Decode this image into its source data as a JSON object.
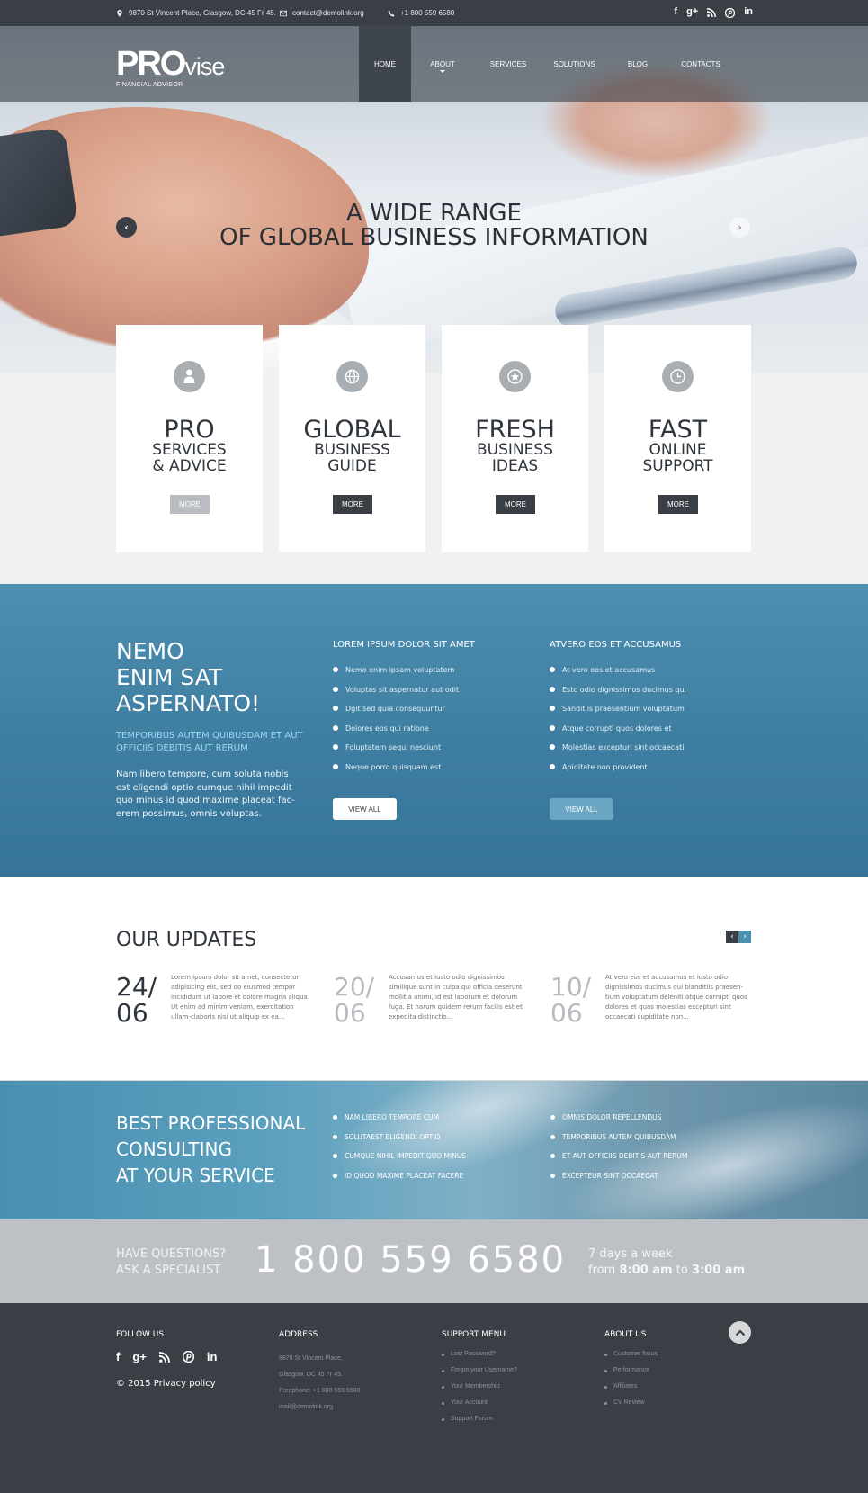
{
  "topbar": {
    "address": "9870 St Vincent Place, Glasgow, DC 45 Fr 45.",
    "email": "contact@demolink.org",
    "phone": "+1 800 559 6580",
    "socials": [
      "f",
      "g+",
      "rss",
      "p",
      "in"
    ]
  },
  "logo": {
    "bold": "PRO",
    "light": "vise",
    "tagline": "FINANCIAL ADVISOR"
  },
  "nav": {
    "items": [
      "HOME",
      "ABOUT",
      "SERVICES",
      "SOLUTIONS",
      "BLOG",
      "CONTACTS"
    ],
    "active": "HOME"
  },
  "hero": {
    "line1": "A WIDE RANGE",
    "line2": "OF GLOBAL BUSINESS INFORMATION",
    "prev": "‹",
    "next": "›"
  },
  "features": [
    {
      "icon": "person-icon",
      "l1": "PRO",
      "l2": "SERVICES",
      "l3": "& ADVICE",
      "button": "MORE",
      "button_color": "#b9bcc0"
    },
    {
      "icon": "globe-icon",
      "l1": "GLOBAL",
      "l2": "BUSINESS",
      "l3": "GUIDE",
      "button": "MORE",
      "button_color": "#3a3f46"
    },
    {
      "icon": "star-icon",
      "l1": "FRESH",
      "l2": "BUSINESS",
      "l3": "IDEAS",
      "button": "MORE",
      "button_color": "#3a3f46"
    },
    {
      "icon": "clock-icon",
      "l1": "FAST",
      "l2": "ONLINE",
      "l3": "SUPPORT",
      "button": "MORE",
      "button_color": "#3a3f46"
    }
  ],
  "info": {
    "heading": [
      "NEMO",
      "ENIM SAT",
      "ASPERNATO!"
    ],
    "subheading": "TEMPORIBUS AUTEM QUIBUSDAM ET AUT OFFICIIS DEBITIS AUT RERUM",
    "paragraph": "Nam libero tempore, cum soluta nobis est eligendi optio cumque nihil impedit quo minus id quod maxime placeat fac-erem possimus, omnis voluptas.",
    "col1": {
      "title": "LOREM IPSUM DOLOR SIT AMET",
      "items": [
        "Nemo enim ipsam voluptatem",
        "Voluptas sit aspernatur aut odit",
        "Dgit sed quia consequuntur",
        "Dolores eos qui ratione",
        "Foluptatem sequi nesciunt",
        "Neque porro quisquam est"
      ],
      "button": "VIEW ALL"
    },
    "col2": {
      "title": "ATVERO EOS ET ACCUSAMUS",
      "items": [
        "At vero eos et accusamus",
        "Esto odio dignissimos ducimus qui",
        "Sanditiis praesentium voluptatum",
        "Atque corrupti quos dolores et",
        "Molestias excepturi sint occaecati",
        "Apiditate non provident"
      ],
      "button": "VIEW ALL"
    }
  },
  "updates": {
    "title": "OUR UPDATES",
    "prev": "‹",
    "next": "›",
    "posts": [
      {
        "day": "24/",
        "month": "06",
        "text": "Lorem ipsum dolor sit amet, consectetur adipisicing elit, sed do eiusmod tempor incididunt ut labore et dolore magna aliqua. Ut enim ad minim veniam, exercitation ullam-claboris nisi ut aliquip ex ea..."
      },
      {
        "day": "20/",
        "month": "06",
        "text": "Accusamus et iusto odio dignissimos similique sunt in culpa qui officia deserunt mollitia animi, id est laborum et dolorum fuga. Et harum quidem rerum facilis est et expedita distinctio..."
      },
      {
        "day": "10/",
        "month": "06",
        "text": "At vero eos et accusamus et iusto odio dignissimos ducimus qui blanditiis praesen-tium voluptatum deleniti atque corrupti quos dolores et quas molestias excepturi sint occaecati cupiditate non..."
      }
    ]
  },
  "consulting": {
    "heading": [
      "BEST PROFESSIONAL",
      "CONSULTING",
      "AT YOUR SERVICE"
    ],
    "list1": [
      "NAM LIBERO TEMPORE CUM",
      "SOLUTAEST ELIGENDI OPTIO",
      "CUMQUE NIHIL IMPEDIT QUO MINUS",
      "ID QUOD MAXIME PLACEAT FACERE"
    ],
    "list2": [
      "OMNIS DOLOR REPELLENDUS",
      "TEMPORIBUS AUTEM QUIBUSDAM",
      "ET AUT OFFICIIS DEBITIS AUT RERUM",
      "EXCEPTEUR SINT OCCAECAT"
    ]
  },
  "phone_band": {
    "question1": "HAVE QUESTIONS?",
    "question2": "ASK A SPECIALIST",
    "number": "1 800 559 6580",
    "hours1": "7 days a week",
    "hours_from": "from",
    "hours_start": "8:00 am",
    "hours_to": "to",
    "hours_end": "3:00 am"
  },
  "footer": {
    "follow_title": "FOLLOW US",
    "socials": [
      "f",
      "g+",
      "rss",
      "p",
      "in"
    ],
    "copyright": "© 2015 Privacy policy",
    "address_title": "ADDRESS",
    "address_lines": [
      "9870 St Vincent Place,",
      "Glasgow, DC 45 Fr 45.",
      "Freephone: +1 800 559 6580",
      "mail@demolink.org"
    ],
    "support_title": "SUPPORT MENU",
    "support_items": [
      "Lost Password?",
      "Forgot your Username?",
      "Your Membership",
      "Your Account",
      "Support Forum"
    ],
    "about_title": "ABOUT US",
    "about_items": [
      "Customer focus",
      "Performance",
      "Affiliates",
      "CV Review"
    ],
    "to_top": "^"
  }
}
